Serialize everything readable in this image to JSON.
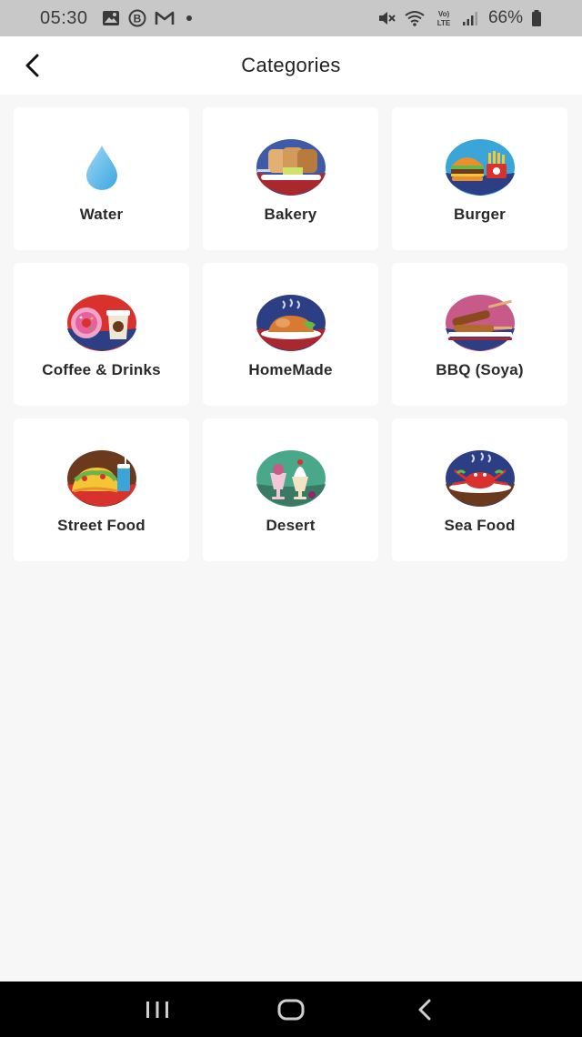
{
  "status_bar": {
    "time": "05:30",
    "battery": "66%",
    "left_icons": [
      "image-icon",
      "b-circle-icon",
      "gmail-icon",
      "dot-icon"
    ],
    "right_icons": [
      "mute-icon",
      "wifi-icon",
      "volte-icon",
      "signal-icon",
      "battery-icon"
    ]
  },
  "app_bar": {
    "title": "Categories",
    "back_icon": "back-arrow-icon"
  },
  "categories": [
    {
      "label": "Water",
      "icon": "water-drop-icon"
    },
    {
      "label": "Bakery",
      "icon": "bakery-icon"
    },
    {
      "label": "Burger",
      "icon": "burger-icon"
    },
    {
      "label": "Coffee & Drinks",
      "icon": "coffee-drinks-icon"
    },
    {
      "label": "HomeMade",
      "icon": "homemade-icon"
    },
    {
      "label": "BBQ (Soya)",
      "icon": "bbq-icon"
    },
    {
      "label": "Street Food",
      "icon": "street-food-icon"
    },
    {
      "label": "Desert",
      "icon": "dessert-icon"
    },
    {
      "label": "Sea Food",
      "icon": "seafood-icon"
    }
  ],
  "nav_bar": {
    "buttons": [
      "recents-icon",
      "home-icon",
      "back-icon"
    ]
  }
}
